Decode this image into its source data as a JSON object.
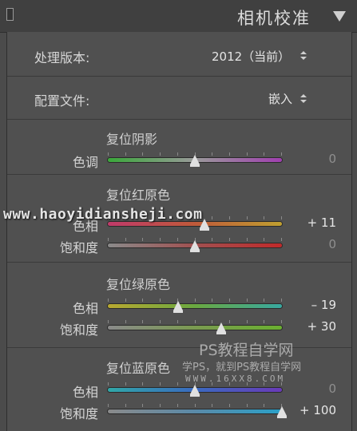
{
  "header": {
    "title": "相机校准"
  },
  "process_version": {
    "label": "处理版本:",
    "value": "2012（当前）"
  },
  "profile": {
    "label": "配置文件:",
    "value": "嵌入"
  },
  "shadows": {
    "title": "复位阴影",
    "sliders": [
      {
        "label": "色调",
        "value": "0",
        "level": 0.5,
        "gradient": [
          "#3aa83a",
          "#9a9a9a",
          "#a03fb0"
        ]
      }
    ]
  },
  "red_primary": {
    "title": "复位红原色",
    "sliders": [
      {
        "label": "色相",
        "value": "+ 11",
        "level": 0.555,
        "gradient": [
          "#c03a6a",
          "#c05a3a",
          "#c0a030"
        ]
      },
      {
        "label": "饱和度",
        "value": "0",
        "level": 0.5,
        "gradient": [
          "#8a8a8a",
          "#a05050",
          "#c02a2a"
        ]
      }
    ]
  },
  "green_primary": {
    "title": "复位绿原色",
    "sliders": [
      {
        "label": "色相",
        "value": "– 19",
        "level": 0.405,
        "gradient": [
          "#b8a830",
          "#6aa840",
          "#38a8a0"
        ]
      },
      {
        "label": "饱和度",
        "value": "+ 30",
        "level": 0.65,
        "gradient": [
          "#8a8a8a",
          "#7a9a50",
          "#6ab030"
        ]
      }
    ]
  },
  "blue_primary": {
    "title": "复位蓝原色",
    "sliders": [
      {
        "label": "色相",
        "value": "0",
        "level": 0.5,
        "gradient": [
          "#30a8a8",
          "#3a6ac0",
          "#6a3ab8"
        ]
      },
      {
        "label": "饱和度",
        "value": "+ 100",
        "level": 1.0,
        "gradient": [
          "#8a8a8a",
          "#5a8aa8",
          "#2aa0c8"
        ]
      }
    ]
  },
  "watermarks": {
    "url": "www.haoyidiansheji.com",
    "brand": "PS教程自学网",
    "tagline": "学PS，就到PS教程自学网",
    "site": "WWW.16XX8.COM"
  }
}
